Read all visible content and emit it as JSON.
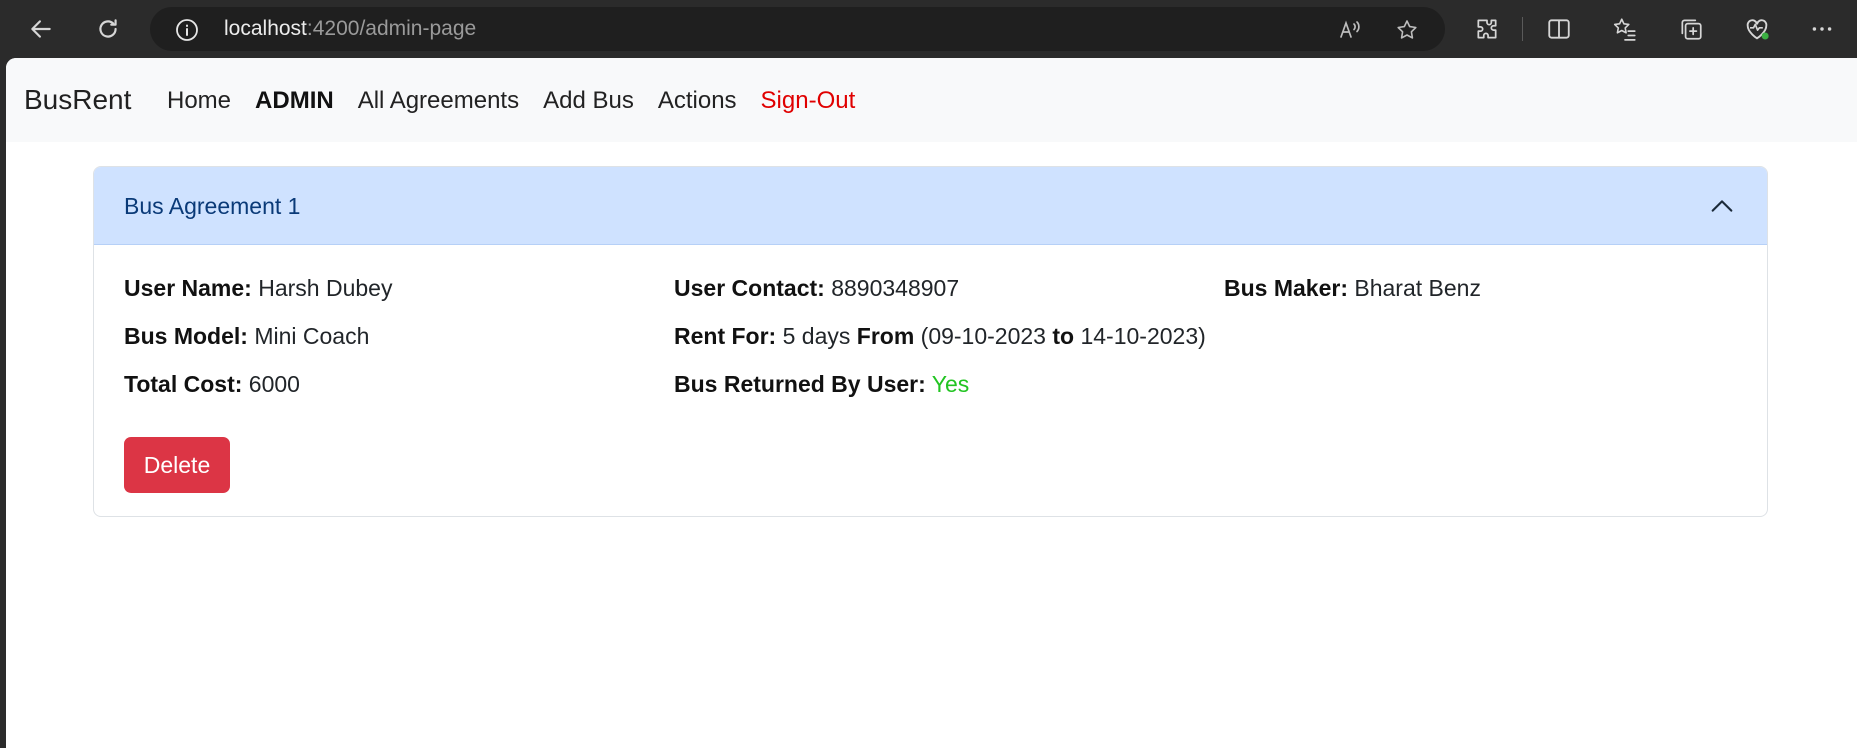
{
  "browser": {
    "url_host": "localhost",
    "url_path": ":4200/admin-page",
    "icons": [
      "back-icon",
      "refresh-icon",
      "info-icon",
      "read-aloud-icon",
      "favorite-star-icon",
      "extensions-icon",
      "split-screen-icon",
      "favorites-list-icon",
      "collections-icon",
      "browser-essentials-icon",
      "more-options-icon"
    ]
  },
  "nav": {
    "brand": "BusRent",
    "home": "Home",
    "admin": "ADMIN",
    "agreements": "All Agreements",
    "add_bus": "Add Bus",
    "actions": "Actions",
    "signout": "Sign-Out"
  },
  "agreement": {
    "title": "Bus Agreement 1",
    "user_name_label": "User Name:",
    "user_name": "Harsh Dubey",
    "user_contact_label": "User Contact:",
    "user_contact": "8890348907",
    "bus_maker_label": "Bus Maker:",
    "bus_maker": "Bharat Benz",
    "bus_model_label": "Bus Model:",
    "bus_model": "Mini Coach",
    "rent_for_label": "Rent For:",
    "rent_days": "5 days",
    "from_label": "From",
    "from_date": "(09-10-2023",
    "to_label": "to",
    "to_date": "14-10-2023)",
    "total_cost_label": "Total Cost:",
    "total_cost": "6000",
    "returned_label": "Bus Returned By User:",
    "returned": "Yes",
    "delete_label": "Delete"
  },
  "colors": {
    "chrome": "#2b2b2b",
    "accordion_header": "#cfe2ff",
    "danger": "#dc3545",
    "signout": "#e00000",
    "returned_yes": "#22c422"
  }
}
